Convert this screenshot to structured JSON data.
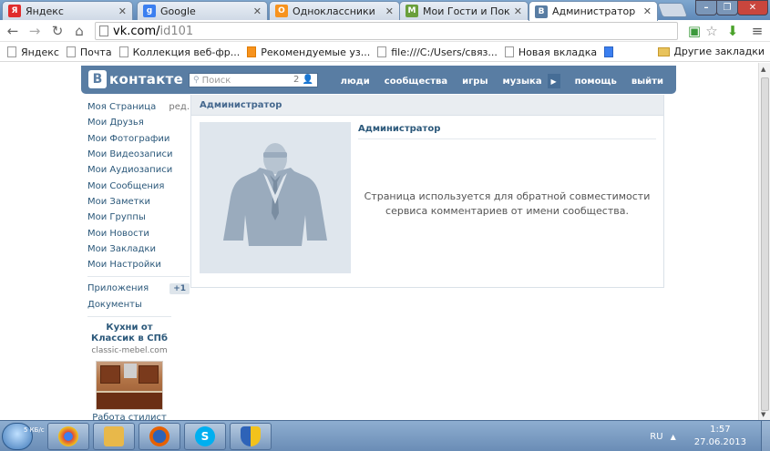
{
  "browser": {
    "tabs": [
      {
        "label": "Яндекс",
        "icon": "yandex-favicon",
        "color": "#e02c2c",
        "glyph": "Я"
      },
      {
        "label": "Google",
        "icon": "google-favicon",
        "color": "#3b7ff0",
        "glyph": "g"
      },
      {
        "label": "Одноклассники",
        "icon": "ok-favicon",
        "color": "#f7931e",
        "glyph": "O"
      },
      {
        "label": "Мои Гости и Поклонники",
        "icon": "guests-app-favicon",
        "color": "#6a9f3b",
        "glyph": "M"
      },
      {
        "label": "Администратор",
        "icon": "vk-favicon",
        "color": "#597da3",
        "glyph": "B"
      }
    ],
    "address": {
      "host": "vk.com/",
      "path": "id101"
    },
    "bookmarks": [
      {
        "label": "Яндекс",
        "icon": "page-icon"
      },
      {
        "label": "Почта",
        "icon": "page-icon"
      },
      {
        "label": "Коллекция веб-фр...",
        "icon": "page-icon"
      },
      {
        "label": "Рекомендуемые уз...",
        "icon": "orange-bookmark-icon"
      },
      {
        "label": "file:///C:/Users/связ...",
        "icon": "page-icon"
      },
      {
        "label": "Новая вкладка",
        "icon": "page-icon"
      },
      {
        "label": "",
        "icon": "google-bookmark-icon"
      }
    ],
    "other_bookmarks": "Другие закладки"
  },
  "vk": {
    "logo_text": "контакте",
    "logo_letter": "В",
    "search_placeholder": "Поиск",
    "search_count": "2",
    "nav": [
      "люди",
      "сообщества",
      "игры",
      "музыка",
      "помощь",
      "выйти"
    ],
    "menu": [
      {
        "label": "Моя Страница",
        "edit": "ред."
      },
      {
        "label": "Мои Друзья"
      },
      {
        "label": "Мои Фотографии"
      },
      {
        "label": "Мои Видеозаписи"
      },
      {
        "label": "Мои Аудиозаписи"
      },
      {
        "label": "Мои Сообщения"
      },
      {
        "label": "Мои Заметки"
      },
      {
        "label": "Мои Группы"
      },
      {
        "label": "Мои Новости"
      },
      {
        "label": "Мои Закладки"
      },
      {
        "label": "Мои Настройки"
      }
    ],
    "menu_extra": [
      {
        "label": "Приложения",
        "badge": "+1"
      },
      {
        "label": "Документы"
      }
    ],
    "ad": {
      "title": "Кухни от Классик в СПб",
      "domain": "classic-mebel.com",
      "more": "Работа стилист"
    },
    "profile": {
      "header": "Администратор",
      "name": "Администратор",
      "info": "Страница используется для обратной совместимости сервиса комментариев от имени сообщества."
    }
  },
  "taskbar": {
    "net_speed": "5 КБ/с",
    "lang": "RU",
    "time": "1:57",
    "date": "27.06.2013",
    "apps": [
      {
        "name": "chrome-icon",
        "color": "#dd4b39"
      },
      {
        "name": "explorer-icon",
        "color": "#e8b84a"
      },
      {
        "name": "firefox-icon",
        "color": "#e66000"
      },
      {
        "name": "skype-icon",
        "color": "#00aff0"
      },
      {
        "name": "security-shield-icon",
        "color": "#f2c21c"
      }
    ]
  }
}
